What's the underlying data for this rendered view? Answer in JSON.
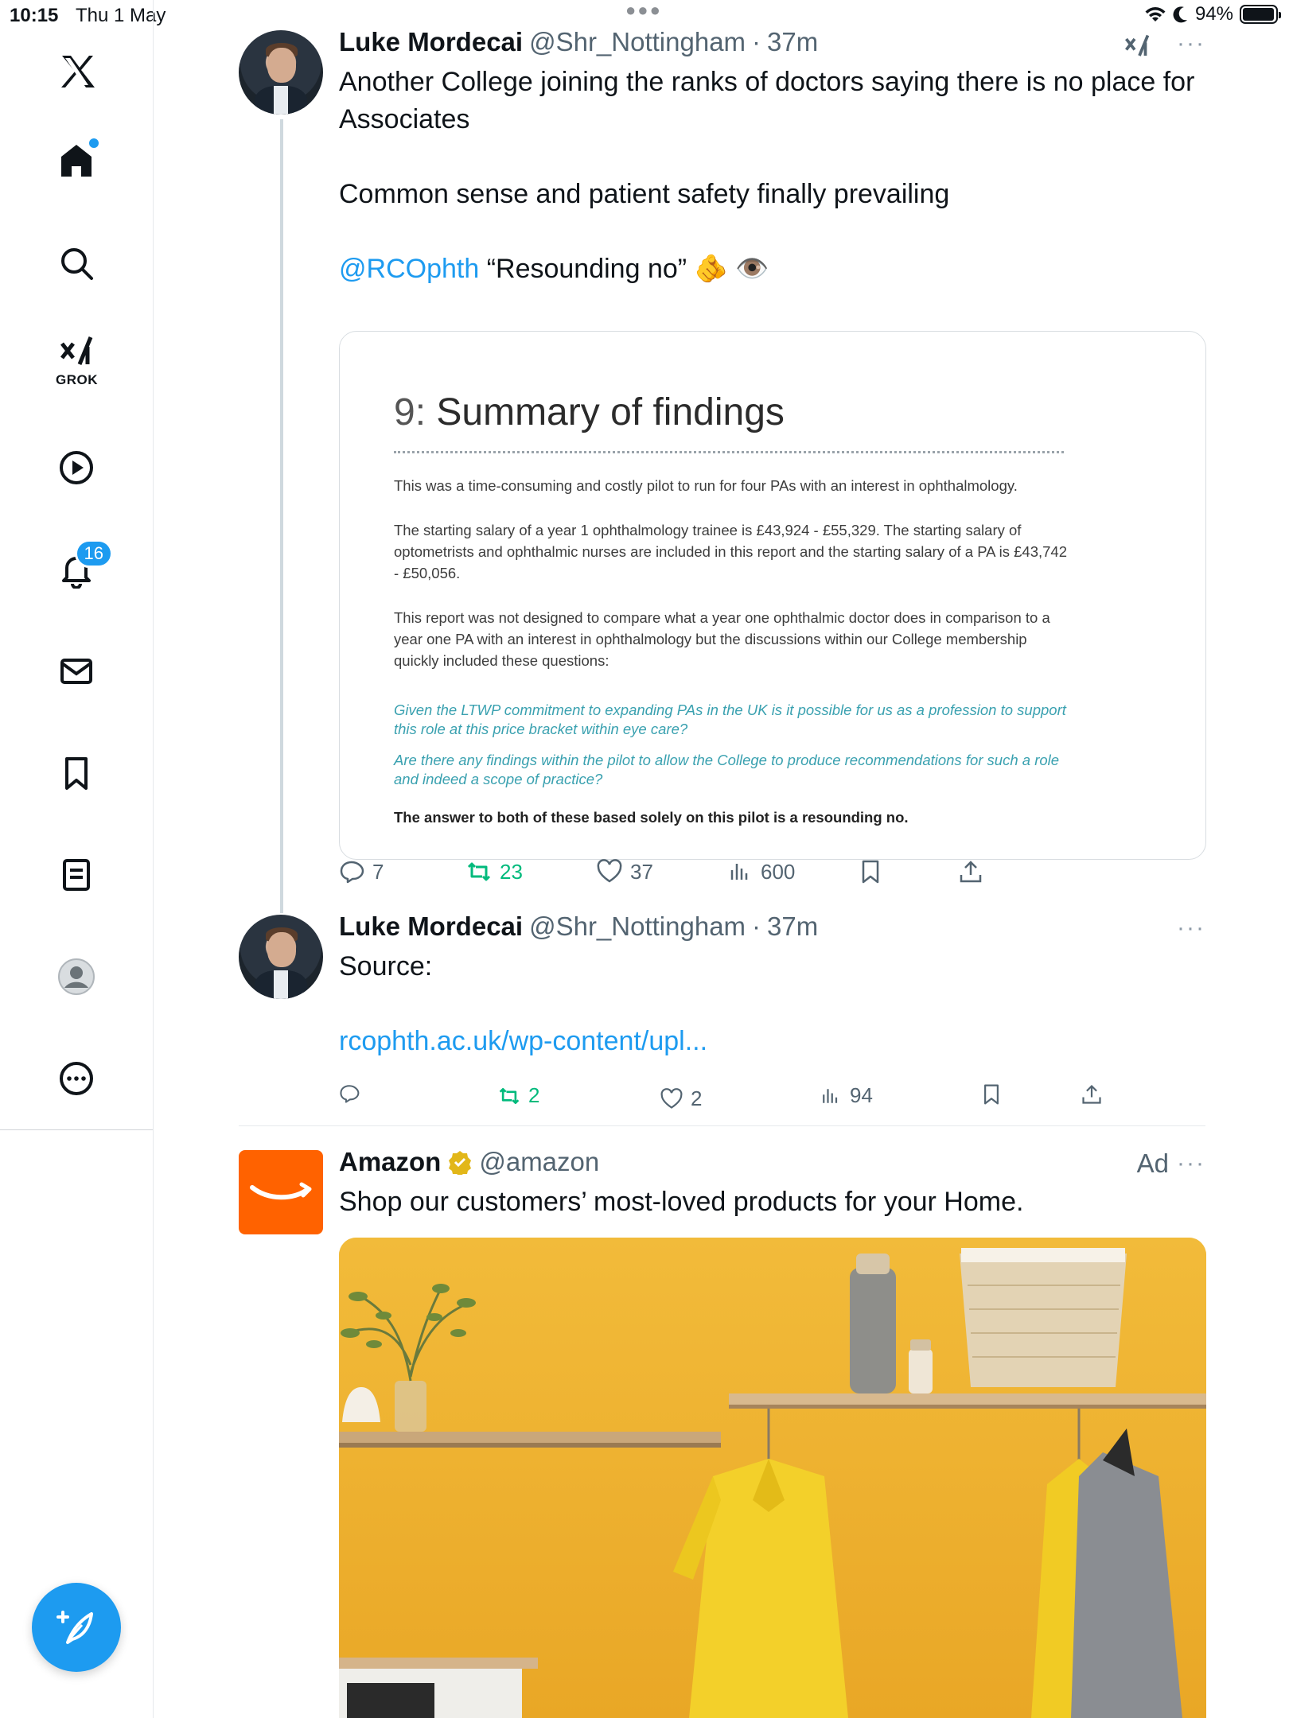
{
  "status": {
    "time": "10:15",
    "date": "Thu 1 May",
    "battery": "94%"
  },
  "sidebar": {
    "grok_label": "GROK",
    "notifications_count": "16"
  },
  "tweets": [
    {
      "name": "Luke Mordecai",
      "handle": "@Shr_Nottingham",
      "sep": "·",
      "time": "37m",
      "more": "···",
      "text_line1": "Another College joining the ranks of doctors saying there is no place for Associates",
      "text_line2": "Common sense and patient safety finally prevailing",
      "mention": "@RCOphth",
      "quote": "“Resounding no” 🫵 👁️",
      "card": {
        "title_num": "9:",
        "title": "Summary of findings",
        "p1": "This was a time-consuming and costly pilot to run for four PAs with an interest in ophthalmology.",
        "p2": "The starting salary of a year 1 ophthalmology trainee is £43,924 - £55,329. The starting salary of optometrists and ophthalmic nurses are included in this report and the starting salary of a PA is £43,742 - £50,056.",
        "p3": "This report was not designed to compare what a year one ophthalmic doctor does in comparison to a year one PA with an interest in ophthalmology but the discussions within our College membership quickly included these questions:",
        "q1": "Given the LTWP commitment to expanding PAs in the UK is it possible for us as a profession to support this role at this price bracket within eye care?",
        "q2": "Are there any findings within the pilot to allow the College to produce recommendations for such a role and indeed a scope of practice?",
        "answer": "The answer to both of these based solely on this pilot is a resounding no."
      },
      "replies": "7",
      "reposts": "23",
      "likes": "37",
      "views": "600"
    },
    {
      "name": "Luke Mordecai",
      "handle": "@Shr_Nottingham",
      "sep": "·",
      "time": "37m",
      "more": "···",
      "text": "Source:",
      "link": "rcophth.ac.uk/wp-content/upl...",
      "replies": "",
      "reposts": "2",
      "likes": "2",
      "views": "94"
    },
    {
      "name": "Amazon",
      "handle": "@amazon",
      "ad": "Ad",
      "more": "···",
      "text": "Shop our customers’ most-loved products for your Home."
    }
  ],
  "colors": {
    "accent": "#1d9bf0",
    "repost_green": "#00ba7c",
    "amazon_orange": "#ff6200"
  }
}
